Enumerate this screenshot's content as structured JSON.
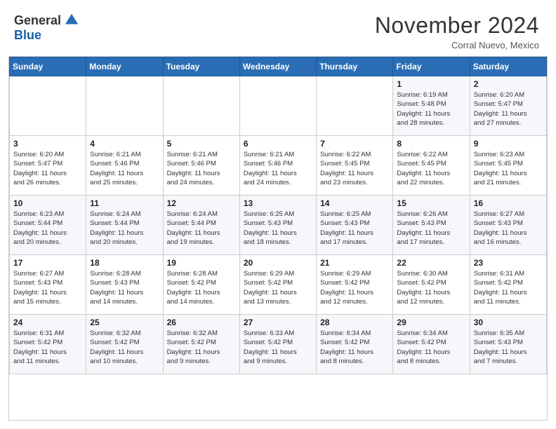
{
  "header": {
    "logo_general": "General",
    "logo_blue": "Blue",
    "month_title": "November 2024",
    "location": "Corral Nuevo, Mexico"
  },
  "calendar": {
    "weekdays": [
      "Sunday",
      "Monday",
      "Tuesday",
      "Wednesday",
      "Thursday",
      "Friday",
      "Saturday"
    ],
    "weeks": [
      [
        {
          "day": "",
          "info": ""
        },
        {
          "day": "",
          "info": ""
        },
        {
          "day": "",
          "info": ""
        },
        {
          "day": "",
          "info": ""
        },
        {
          "day": "",
          "info": ""
        },
        {
          "day": "1",
          "info": "Sunrise: 6:19 AM\nSunset: 5:48 PM\nDaylight: 11 hours\nand 28 minutes."
        },
        {
          "day": "2",
          "info": "Sunrise: 6:20 AM\nSunset: 5:47 PM\nDaylight: 11 hours\nand 27 minutes."
        }
      ],
      [
        {
          "day": "3",
          "info": "Sunrise: 6:20 AM\nSunset: 5:47 PM\nDaylight: 11 hours\nand 26 minutes."
        },
        {
          "day": "4",
          "info": "Sunrise: 6:21 AM\nSunset: 5:46 PM\nDaylight: 11 hours\nand 25 minutes."
        },
        {
          "day": "5",
          "info": "Sunrise: 6:21 AM\nSunset: 5:46 PM\nDaylight: 11 hours\nand 24 minutes."
        },
        {
          "day": "6",
          "info": "Sunrise: 6:21 AM\nSunset: 5:46 PM\nDaylight: 11 hours\nand 24 minutes."
        },
        {
          "day": "7",
          "info": "Sunrise: 6:22 AM\nSunset: 5:45 PM\nDaylight: 11 hours\nand 23 minutes."
        },
        {
          "day": "8",
          "info": "Sunrise: 6:22 AM\nSunset: 5:45 PM\nDaylight: 11 hours\nand 22 minutes."
        },
        {
          "day": "9",
          "info": "Sunrise: 6:23 AM\nSunset: 5:45 PM\nDaylight: 11 hours\nand 21 minutes."
        }
      ],
      [
        {
          "day": "10",
          "info": "Sunrise: 6:23 AM\nSunset: 5:44 PM\nDaylight: 11 hours\nand 20 minutes."
        },
        {
          "day": "11",
          "info": "Sunrise: 6:24 AM\nSunset: 5:44 PM\nDaylight: 11 hours\nand 20 minutes."
        },
        {
          "day": "12",
          "info": "Sunrise: 6:24 AM\nSunset: 5:44 PM\nDaylight: 11 hours\nand 19 minutes."
        },
        {
          "day": "13",
          "info": "Sunrise: 6:25 AM\nSunset: 5:43 PM\nDaylight: 11 hours\nand 18 minutes."
        },
        {
          "day": "14",
          "info": "Sunrise: 6:25 AM\nSunset: 5:43 PM\nDaylight: 11 hours\nand 17 minutes."
        },
        {
          "day": "15",
          "info": "Sunrise: 6:26 AM\nSunset: 5:43 PM\nDaylight: 11 hours\nand 17 minutes."
        },
        {
          "day": "16",
          "info": "Sunrise: 6:27 AM\nSunset: 5:43 PM\nDaylight: 11 hours\nand 16 minutes."
        }
      ],
      [
        {
          "day": "17",
          "info": "Sunrise: 6:27 AM\nSunset: 5:43 PM\nDaylight: 11 hours\nand 15 minutes."
        },
        {
          "day": "18",
          "info": "Sunrise: 6:28 AM\nSunset: 5:43 PM\nDaylight: 11 hours\nand 14 minutes."
        },
        {
          "day": "19",
          "info": "Sunrise: 6:28 AM\nSunset: 5:42 PM\nDaylight: 11 hours\nand 14 minutes."
        },
        {
          "day": "20",
          "info": "Sunrise: 6:29 AM\nSunset: 5:42 PM\nDaylight: 11 hours\nand 13 minutes."
        },
        {
          "day": "21",
          "info": "Sunrise: 6:29 AM\nSunset: 5:42 PM\nDaylight: 11 hours\nand 12 minutes."
        },
        {
          "day": "22",
          "info": "Sunrise: 6:30 AM\nSunset: 5:42 PM\nDaylight: 11 hours\nand 12 minutes."
        },
        {
          "day": "23",
          "info": "Sunrise: 6:31 AM\nSunset: 5:42 PM\nDaylight: 11 hours\nand 11 minutes."
        }
      ],
      [
        {
          "day": "24",
          "info": "Sunrise: 6:31 AM\nSunset: 5:42 PM\nDaylight: 11 hours\nand 11 minutes."
        },
        {
          "day": "25",
          "info": "Sunrise: 6:32 AM\nSunset: 5:42 PM\nDaylight: 11 hours\nand 10 minutes."
        },
        {
          "day": "26",
          "info": "Sunrise: 6:32 AM\nSunset: 5:42 PM\nDaylight: 11 hours\nand 9 minutes."
        },
        {
          "day": "27",
          "info": "Sunrise: 6:33 AM\nSunset: 5:42 PM\nDaylight: 11 hours\nand 9 minutes."
        },
        {
          "day": "28",
          "info": "Sunrise: 6:34 AM\nSunset: 5:42 PM\nDaylight: 11 hours\nand 8 minutes."
        },
        {
          "day": "29",
          "info": "Sunrise: 6:34 AM\nSunset: 5:42 PM\nDaylight: 11 hours\nand 8 minutes."
        },
        {
          "day": "30",
          "info": "Sunrise: 6:35 AM\nSunset: 5:43 PM\nDaylight: 11 hours\nand 7 minutes."
        }
      ]
    ]
  }
}
